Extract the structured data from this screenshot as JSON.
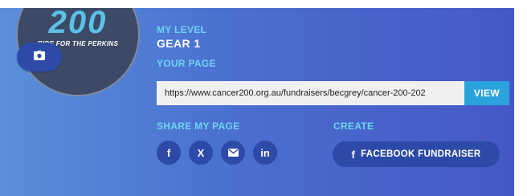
{
  "avatar": {
    "logo_text": "200",
    "tagline": "RIDE FOR THE PERKINS",
    "camera_icon": "camera-icon"
  },
  "level": {
    "label": "MY LEVEL",
    "value": "GEAR 1"
  },
  "page": {
    "label": "YOUR PAGE",
    "url": "https://www.cancer200.org.au/fundraisers/becgrey/cancer-200-202",
    "view_label": "VIEW"
  },
  "share": {
    "label": "SHARE MY PAGE",
    "buttons": [
      {
        "icon": "facebook-icon",
        "glyph": "f"
      },
      {
        "icon": "x-icon",
        "glyph": "X"
      },
      {
        "icon": "email-icon",
        "glyph": ""
      },
      {
        "icon": "linkedin-icon",
        "glyph": "in"
      }
    ]
  },
  "create": {
    "label": "CREATE",
    "fundraiser_icon": "f",
    "fundraiser_label": "FACEBOOK FUNDRAISER"
  },
  "colors": {
    "accent_cyan": "#6fd3f2",
    "button_dark": "#2d4aa8",
    "view_button": "#2aa3dd"
  }
}
